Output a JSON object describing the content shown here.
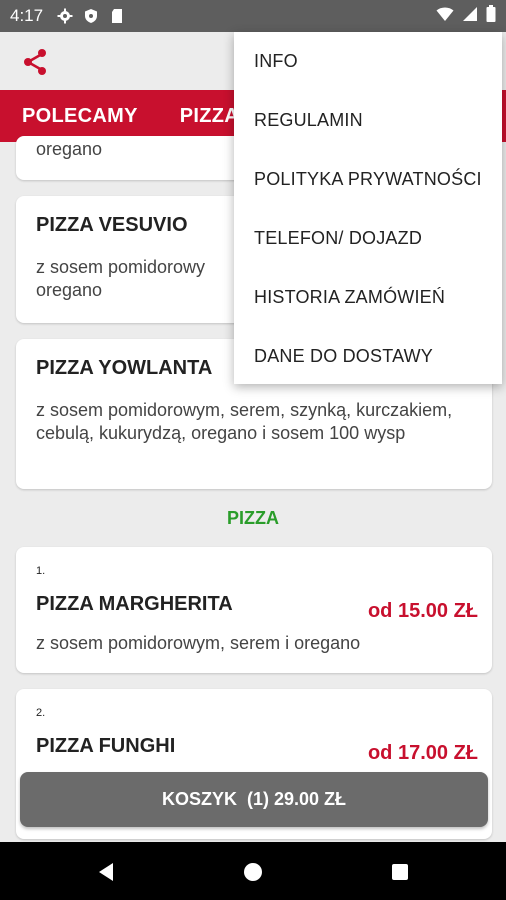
{
  "status_bar": {
    "time": "4:17"
  },
  "tabs": [
    "POLECAMY",
    "PIZZA"
  ],
  "cards": [
    {
      "description": "oregano"
    },
    {
      "title": "PIZZA VESUVIO",
      "description": "z sosem pomidorowy\noregano"
    },
    {
      "title": "PIZZA YOWLANTA",
      "description": "z sosem pomidorowym, serem, szynką, kurczakiem, cebulą, kukurydzą, oregano i sosem 100 wysp"
    },
    {
      "number": "1.",
      "title": "PIZZA MARGHERITA",
      "price": "od 15.00 ZŁ",
      "description": "z sosem pomidorowym, serem i oregano"
    },
    {
      "number": "2.",
      "title": "PIZZA FUNGHI",
      "price": "od 17.00 ZŁ"
    }
  ],
  "section_heading": "PIZZA",
  "cart_button": "KOSZYK  (1) 29.00 ZŁ",
  "menu": [
    "INFO",
    "REGULAMIN",
    "POLITYKA PRYWATNOŚCI",
    "TELEFON/ DOJAZD",
    "HISTORIA ZAMÓWIEŃ",
    "DANE DO DOSTAWY"
  ],
  "colors": {
    "accent": "#c8102e",
    "section": "#2a9d2a",
    "cart": "#6b6b6b"
  },
  "icons": [
    "settings-icon",
    "shield-icon",
    "sd-card-icon",
    "wifi-icon",
    "signal-icon",
    "battery-icon",
    "share-icon",
    "back-icon",
    "home-icon",
    "recents-icon"
  ]
}
